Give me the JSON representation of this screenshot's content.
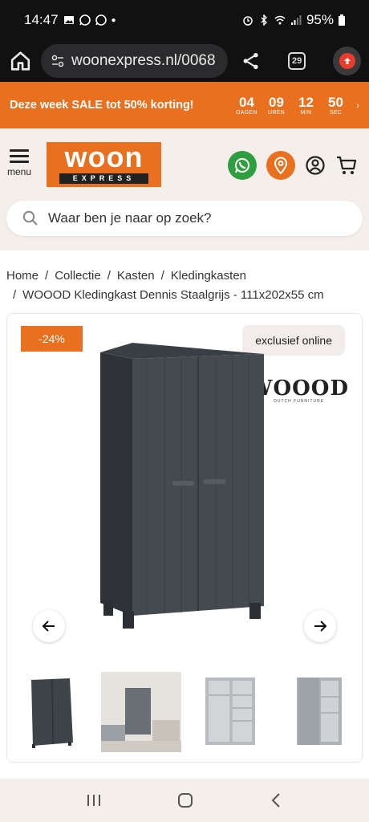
{
  "status_bar": {
    "time": "14:47",
    "battery": "95%"
  },
  "browser": {
    "url": "woonexpress.nl/0068",
    "tab_count": "29"
  },
  "promo": {
    "text": "Deze week SALE tot 50% korting!",
    "countdown": [
      {
        "value": "04",
        "label": "DAGEN"
      },
      {
        "value": "09",
        "label": "UREN"
      },
      {
        "value": "12",
        "label": "MIN"
      },
      {
        "value": "50",
        "label": "SEC"
      }
    ]
  },
  "header": {
    "menu_label": "menu",
    "logo_main": "woon",
    "logo_sub": "EXPRESS",
    "search_placeholder": "Waar ben je naar op zoek?"
  },
  "breadcrumb": {
    "items": [
      "Home",
      "Collectie",
      "Kasten",
      "Kledingkasten"
    ],
    "current": "WOOOD Kledingkast Dennis Staalgrijs - 111x202x55 cm"
  },
  "product": {
    "discount_badge": "-24%",
    "exclusive_label": "exclusief online",
    "brand_name": "WOOOD",
    "brand_tagline": "DUTCH FURNITURE"
  },
  "colors": {
    "accent": "#e8701e",
    "whatsapp": "#2e9e3e",
    "cabinet": "#43484e"
  }
}
